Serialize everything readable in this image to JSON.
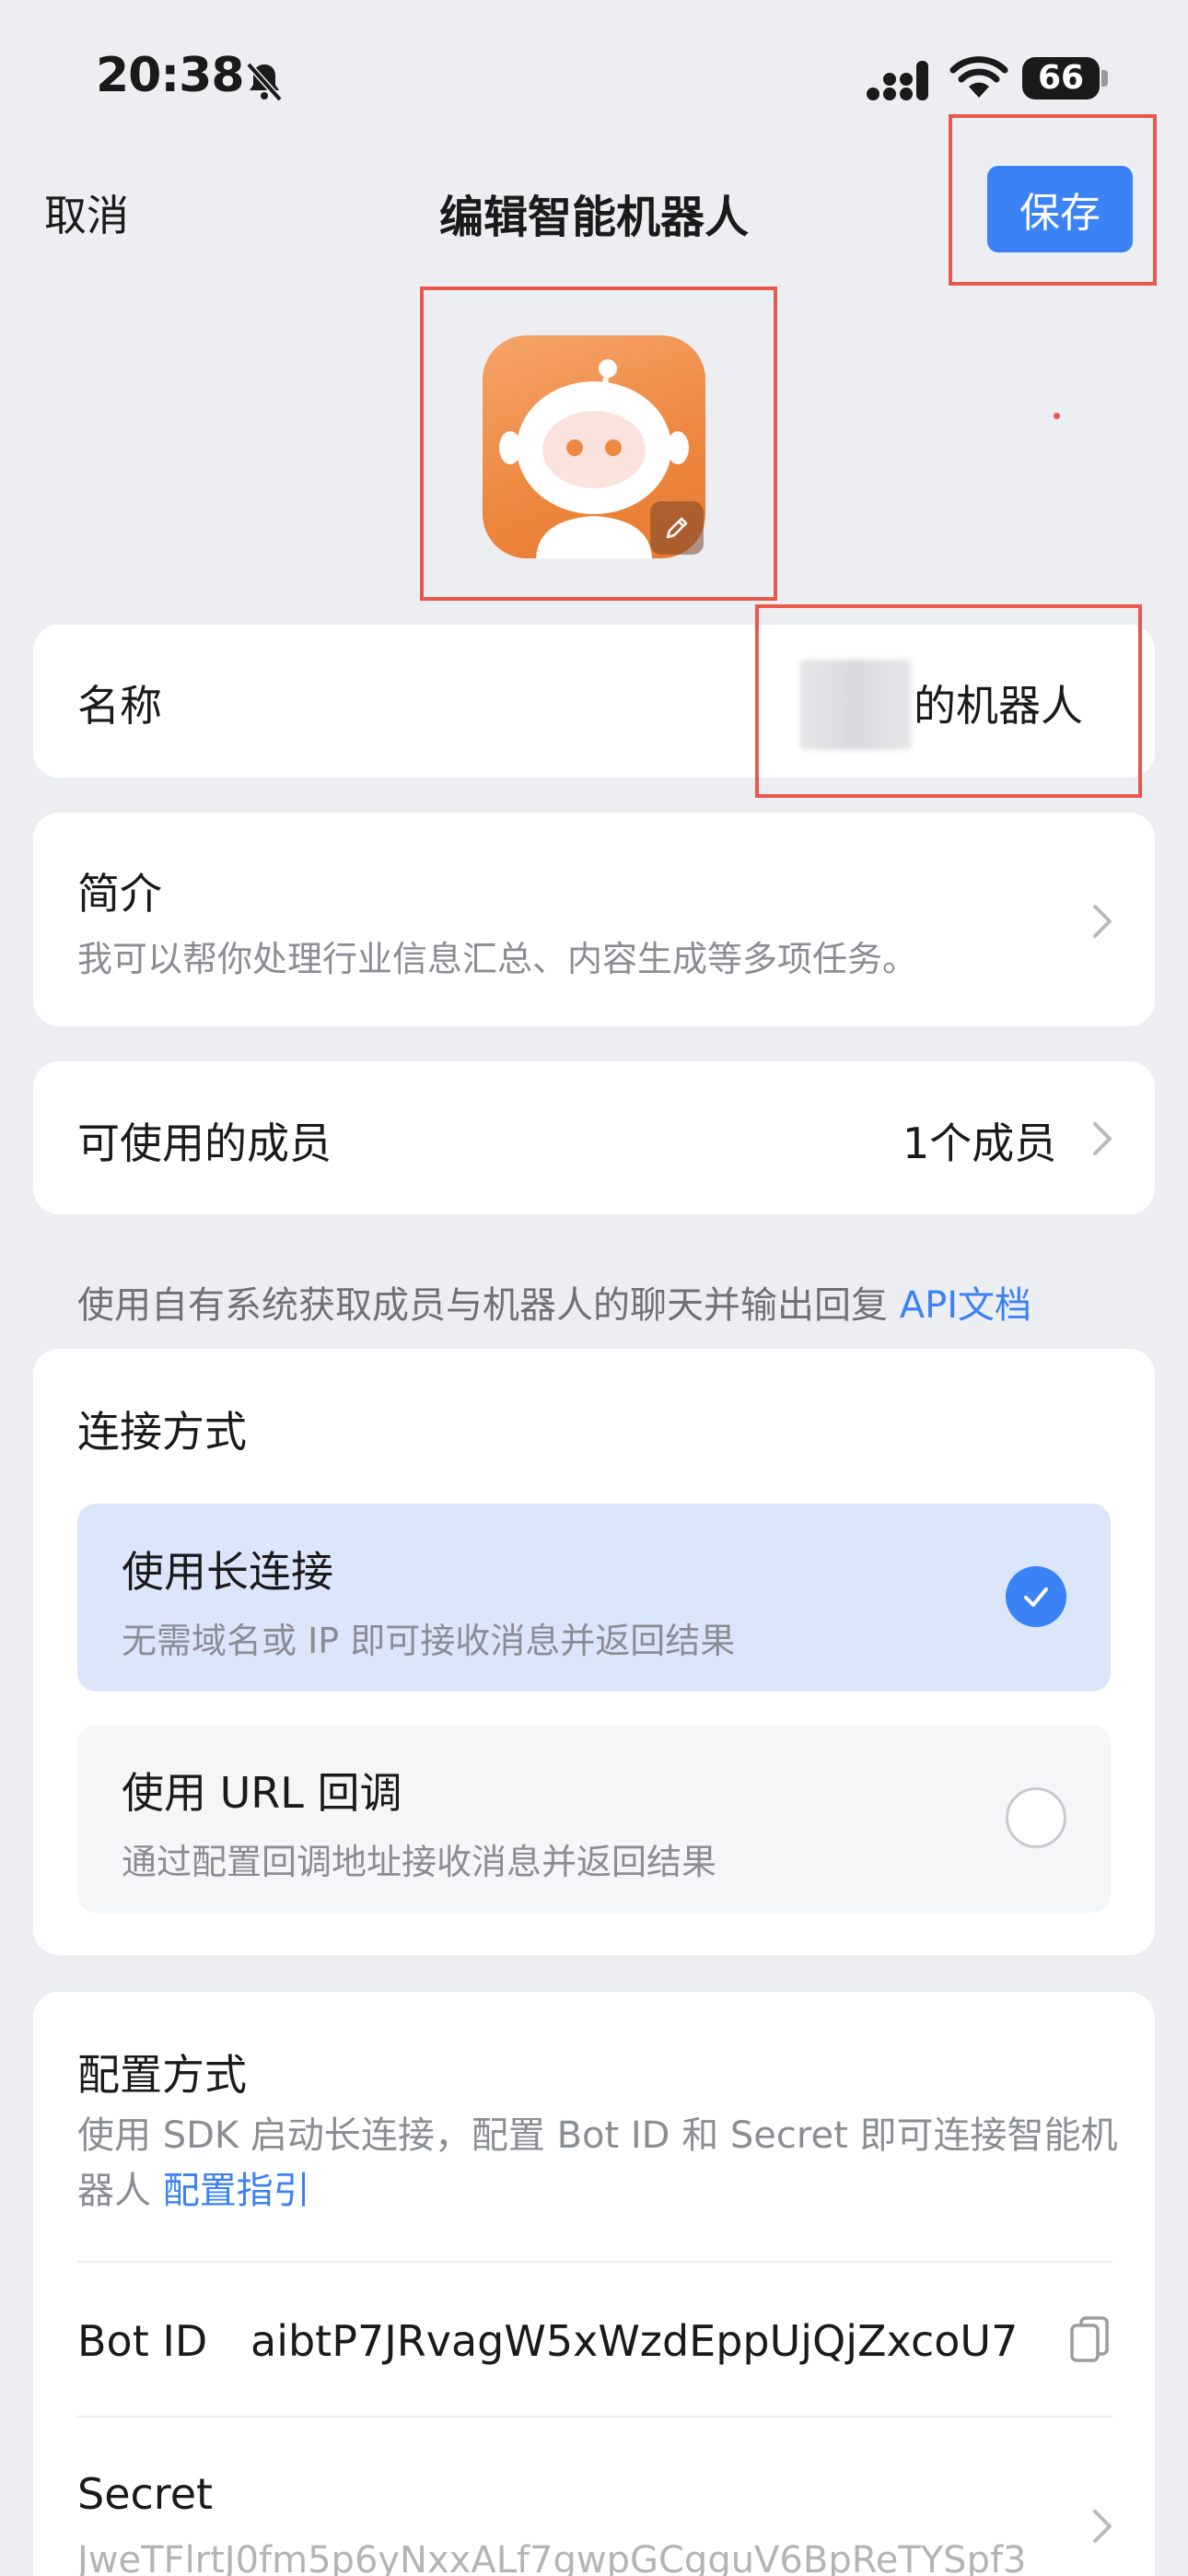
{
  "status_bar": {
    "time": "20:38",
    "battery": "66"
  },
  "nav": {
    "cancel": "取消",
    "title": "编辑智能机器人",
    "save": "保存"
  },
  "name_row": {
    "label": "名称",
    "value": "的机器人"
  },
  "intro_row": {
    "label": "简介",
    "description": "我可以帮你处理行业信息汇总、内容生成等多项任务。"
  },
  "members_row": {
    "label": "可使用的成员",
    "value": "1个成员"
  },
  "api_note": {
    "text": "使用自有系统获取成员与机器人的聊天并输出回复",
    "link": "API文档"
  },
  "connection": {
    "title": "连接方式",
    "options": [
      {
        "title": "使用长连接",
        "subtitle": "无需域名或 IP 即可接收消息并返回结果",
        "selected": true
      },
      {
        "title": "使用 URL 回调",
        "subtitle": "通过配置回调地址接收消息并返回结果",
        "selected": false
      }
    ]
  },
  "config": {
    "title": "配置方式",
    "description": "使用 SDK 启动长连接，配置 Bot ID 和 Secret 即可连接智能机器人",
    "guide_link": "配置指引",
    "bot_id_label": "Bot ID",
    "bot_id_value": "aibtP7JRvagW5xWzdEppUjQjZxcoU7",
    "secret_label": "Secret",
    "secret_value": "JweTFlrtJ0fm5p6yNxxALf7gwpGCgguV6BpReTYSpf3"
  },
  "colors": {
    "accent": "#3B82F6",
    "highlight": "#E8584D",
    "avatar": "#EE8840"
  },
  "icons": [
    "bell-slash-icon",
    "signal-icon",
    "wifi-icon",
    "battery-icon",
    "pencil-icon",
    "chevron-right-icon",
    "check-icon",
    "copy-icon"
  ]
}
